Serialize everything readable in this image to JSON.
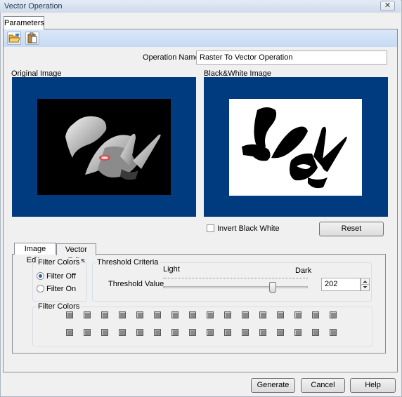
{
  "window": {
    "title": "Vector Operation",
    "close_glyph": "✕"
  },
  "tabs": {
    "parameters": "Parameters"
  },
  "toolbar": {
    "icons": [
      "open-folder-icon",
      "paste-icon"
    ]
  },
  "operation": {
    "label": "Operation Name:",
    "value": "Raster To Vector Operation"
  },
  "original_image": {
    "label": "Original Image"
  },
  "bw_image": {
    "label": "Black&White Image"
  },
  "invert": {
    "label": "Invert Black White",
    "checked": false
  },
  "reset_label": "Reset",
  "edit_tabs": {
    "image_edits": "Image Edits",
    "vector_edits": "Vector Edits"
  },
  "filter_colors": {
    "title": "Filter Colors",
    "options": [
      "Filter Off",
      "Filter On"
    ],
    "selected": "Filter Off",
    "swatch_title": "Filter Colors"
  },
  "threshold": {
    "title": "Threshold Criteria",
    "light": "Light",
    "dark": "Dark",
    "label": "Threshold Value",
    "value": "202",
    "slider_fraction": 0.77
  },
  "footer": {
    "generate": "Generate",
    "cancel": "Cancel",
    "help": "Help"
  },
  "colors": {
    "image_bg": "#003b80",
    "toolbar": "#c5daf3",
    "window": "#f0f0f0"
  }
}
